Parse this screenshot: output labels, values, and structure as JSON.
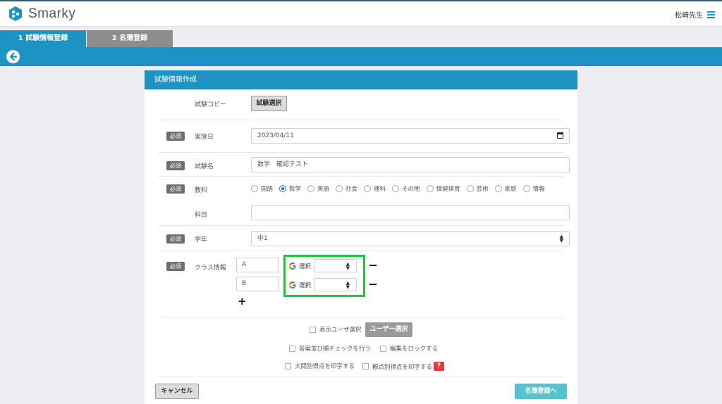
{
  "app": {
    "name": "Smarky",
    "user_name": "松崎先生",
    "brand_color": "#1d93c4",
    "icons": {
      "logo": "smarky-logo-icon",
      "menu": "hamburger-menu-icon",
      "back": "back-arrow-icon"
    }
  },
  "steps": [
    {
      "label": "1  試験情報登録"
    },
    {
      "label": "2  名簿登録"
    }
  ],
  "form": {
    "title": "試験情報作成",
    "required_badge": "必須",
    "copy": {
      "label": "試験コピー",
      "button": "試験選択"
    },
    "date": {
      "label": "実施日",
      "value": "2023/04/11"
    },
    "exam_name": {
      "label": "試験名",
      "value": "数学　確認テスト"
    },
    "subject": {
      "label": "教科",
      "options": [
        "国語",
        "数学",
        "英語",
        "社会",
        "理科",
        "その他",
        "保健体育",
        "芸術",
        "家庭",
        "情報"
      ],
      "selected": "数学"
    },
    "course": {
      "label": "科目",
      "value": ""
    },
    "grade": {
      "label": "学年",
      "value": "中1"
    },
    "class_info": {
      "label": "クラス情報",
      "classes": [
        {
          "name": "A",
          "google_label": "選択",
          "select_value": ""
        },
        {
          "name": "B",
          "google_label": "選択",
          "select_value": ""
        }
      ],
      "highlight_color": "#22c43c"
    },
    "show_user": {
      "label": "表示ユーザ選択",
      "button": "ユーザー選択"
    },
    "checks": {
      "answer_order": "答案並び順チェックを行う",
      "lock_edit": "編集をロックする",
      "print_by_question": "大問別得点を印字する",
      "print_by_viewpoint": "観点別得点を印字する",
      "help": "?"
    },
    "cancel_button": "キャンセル",
    "next_button": "名簿登録へ"
  }
}
